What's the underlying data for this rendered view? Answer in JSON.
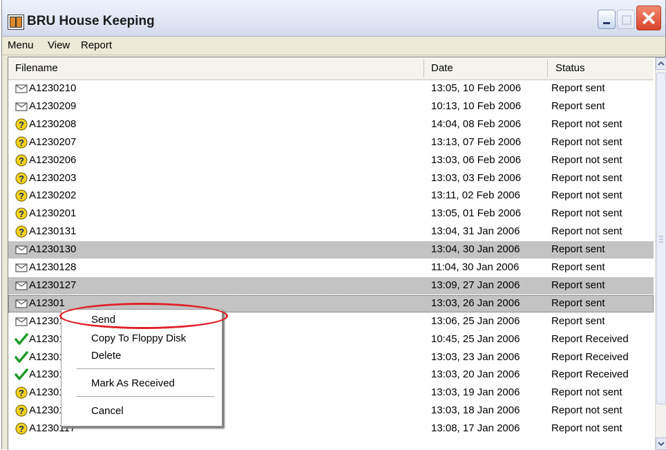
{
  "window": {
    "title": "BRU House Keeping"
  },
  "menubar": {
    "items": [
      "Menu",
      "View",
      "Report"
    ]
  },
  "columns": {
    "filename": "Filename",
    "date": "Date",
    "status": "Status"
  },
  "rows": [
    {
      "name": "A1230210",
      "date": "13:05, 10 Feb 2006",
      "status": "Report sent",
      "icon": "envelope-icon"
    },
    {
      "name": "A1230209",
      "date": "10:13, 10 Feb 2006",
      "status": "Report sent",
      "icon": "envelope-icon"
    },
    {
      "name": "A1230208",
      "date": "14:04, 08 Feb 2006",
      "status": "Report not sent",
      "icon": "question-icon"
    },
    {
      "name": "A1230207",
      "date": "13:13, 07 Feb 2006",
      "status": "Report not sent",
      "icon": "question-icon"
    },
    {
      "name": "A1230206",
      "date": "13:03, 06 Feb 2006",
      "status": "Report not sent",
      "icon": "question-icon"
    },
    {
      "name": "A1230203",
      "date": "13:03, 03 Feb 2006",
      "status": "Report not sent",
      "icon": "question-icon"
    },
    {
      "name": "A1230202",
      "date": "13:11, 02 Feb 2006",
      "status": "Report not sent",
      "icon": "question-icon"
    },
    {
      "name": "A1230201",
      "date": "13:05, 01 Feb 2006",
      "status": "Report not sent",
      "icon": "question-icon"
    },
    {
      "name": "A1230131",
      "date": "13:04, 31 Jan 2006",
      "status": "Report not sent",
      "icon": "question-icon"
    },
    {
      "name": "A1230130",
      "date": "13:04, 30 Jan 2006",
      "status": "Report sent",
      "icon": "envelope-icon",
      "selected": true
    },
    {
      "name": "A1230128",
      "date": "11:04, 30 Jan 2006",
      "status": "Report sent",
      "icon": "envelope-icon"
    },
    {
      "name": "A1230127",
      "date": "13:09, 27 Jan 2006",
      "status": "Report sent",
      "icon": "envelope-icon",
      "selected": true
    },
    {
      "name": "A12301",
      "date": "13:03, 26 Jan 2006",
      "status": "Report sent",
      "icon": "envelope-icon",
      "selected": true,
      "focused": true
    },
    {
      "name": "A12301",
      "date": "13:06, 25 Jan 2006",
      "status": "Report sent",
      "icon": "envelope-icon"
    },
    {
      "name": "A12301",
      "date": "10:45, 25 Jan 2006",
      "status": "Report Received",
      "icon": "checkmark-icon"
    },
    {
      "name": "A12301",
      "date": "13:03, 23 Jan 2006",
      "status": "Report Received",
      "icon": "checkmark-icon"
    },
    {
      "name": "A12301",
      "date": "13:03, 20 Jan 2006",
      "status": "Report Received",
      "icon": "checkmark-icon"
    },
    {
      "name": "A12301",
      "date": "13:03, 19 Jan 2006",
      "status": "Report not sent",
      "icon": "question-icon"
    },
    {
      "name": "A12301",
      "date": "13:03, 18 Jan 2006",
      "status": "Report not sent",
      "icon": "question-icon"
    },
    {
      "name": "A1230117",
      "date": "13:08, 17 Jan 2006",
      "status": "Report not sent",
      "icon": "question-icon"
    }
  ],
  "context_menu": {
    "items": [
      "Send",
      "Copy To Floppy Disk",
      "Delete",
      "Mark As Received",
      "Cancel"
    ]
  },
  "colors": {
    "selection": "#c3c3c3",
    "highlight_ring": "#e0212a"
  }
}
